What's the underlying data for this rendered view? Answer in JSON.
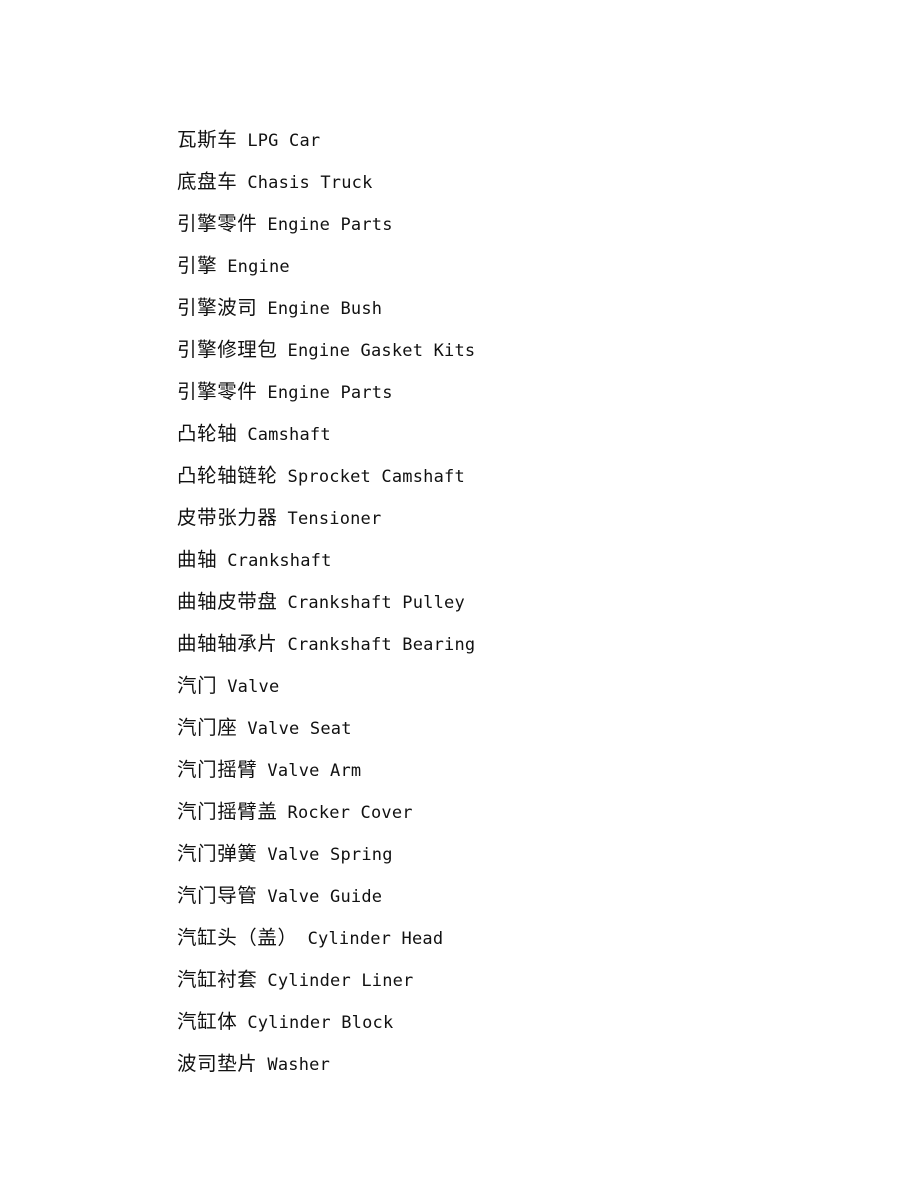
{
  "document": {
    "page_background": "#ffffff",
    "text_color": "#111111",
    "entries": [
      {
        "zh": "瓦斯车",
        "en": "LPG Car"
      },
      {
        "zh": "底盘车",
        "en": "Chasis Truck"
      },
      {
        "zh": "引擎零件",
        "en": "Engine Parts"
      },
      {
        "zh": "引擎",
        "en": "Engine"
      },
      {
        "zh": "引擎波司",
        "en": "Engine Bush"
      },
      {
        "zh": "引擎修理包",
        "en": "Engine Gasket Kits"
      },
      {
        "zh": "引擎零件",
        "en": "Engine Parts"
      },
      {
        "zh": "凸轮轴",
        "en": "Camshaft"
      },
      {
        "zh": "凸轮轴链轮",
        "en": "Sprocket Camshaft"
      },
      {
        "zh": "皮带张力器",
        "en": "Tensioner"
      },
      {
        "zh": "曲轴",
        "en": "Crankshaft"
      },
      {
        "zh": "曲轴皮带盘",
        "en": "Crankshaft Pulley"
      },
      {
        "zh": "曲轴轴承片",
        "en": "Crankshaft Bearing"
      },
      {
        "zh": "汽门",
        "en": "Valve"
      },
      {
        "zh": "汽门座",
        "en": "Valve Seat"
      },
      {
        "zh": "汽门摇臂",
        "en": "Valve Arm"
      },
      {
        "zh": "汽门摇臂盖",
        "en": "Rocker Cover"
      },
      {
        "zh": "汽门弹簧",
        "en": "Valve Spring"
      },
      {
        "zh": "汽门导管",
        "en": "Valve Guide"
      },
      {
        "zh": "汽缸头（盖）",
        "en": "Cylinder Head"
      },
      {
        "zh": "汽缸衬套",
        "en": "Cylinder Liner"
      },
      {
        "zh": "汽缸体",
        "en": "Cylinder Block"
      },
      {
        "zh": "波司垫片",
        "en": "Washer"
      }
    ]
  }
}
